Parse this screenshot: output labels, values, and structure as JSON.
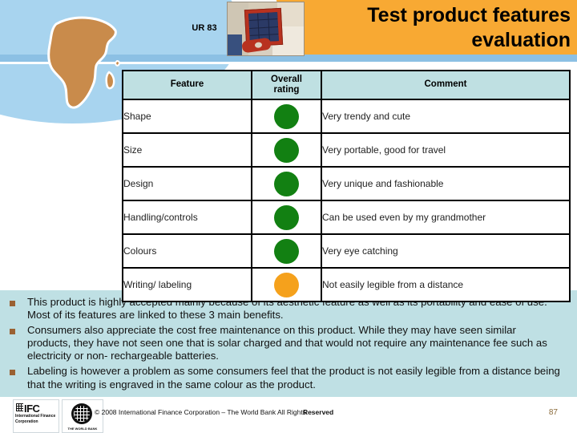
{
  "header": {
    "code_label": "UR 83",
    "title": "Test product features evaluation",
    "title_line1": "Test product features",
    "title_line2": "evaluation",
    "product_photo_alt": "solar-panel-photo",
    "map_alt": "africa-map",
    "banner_color": "#f8a933",
    "accent_blue": "#8cc0e4"
  },
  "table": {
    "columns": [
      "Feature",
      "Overall rating",
      "Comment"
    ],
    "column_header_line1": "Overall",
    "column_header_line2": "rating",
    "rows": [
      {
        "feature": "Shape",
        "rating": "green",
        "rating_color": "#128012",
        "comment": "Very trendy and cute"
      },
      {
        "feature": "Size",
        "rating": "green",
        "rating_color": "#128012",
        "comment": "Very portable, good for travel"
      },
      {
        "feature": "Design",
        "rating": "green",
        "rating_color": "#128012",
        "comment": "Very unique and fashionable"
      },
      {
        "feature": "Handling/controls",
        "rating": "green",
        "rating_color": "#128012",
        "comment": "Can be used even by my grandmother"
      },
      {
        "feature": "Colours",
        "rating": "green",
        "rating_color": "#128012",
        "comment": "Very eye catching"
      },
      {
        "feature": "Writing/ labeling",
        "rating": "orange",
        "rating_color": "#f5a11c",
        "comment": "Not easily legible from a distance"
      }
    ]
  },
  "bullets": [
    "This product is highly accepted mainly because of its aesthetic feature as well as its portability and ease of use. Most of its features are linked to these 3 main benefits.",
    "Consumers also appreciate the cost free maintenance on this product. While they may have seen similar products, they have not seen one that is solar charged and that would not require any maintenance fee such as electricity or non- rechargeable batteries.",
    "Labeling is however a problem as some consumers feel that the product is not easily legible from a distance being that the writing is engraved in the same colour as the product."
  ],
  "footer": {
    "copyright": "© 2008 International Finance Corporation – The World Bank All Rights",
    "copyright_overlap": "Reserved",
    "page_number": "87",
    "ifc_logo_text": "IFC",
    "ifc_logo_sub": "International Finance Corporation",
    "world_bank_caption": "THE WORLD BANK"
  }
}
